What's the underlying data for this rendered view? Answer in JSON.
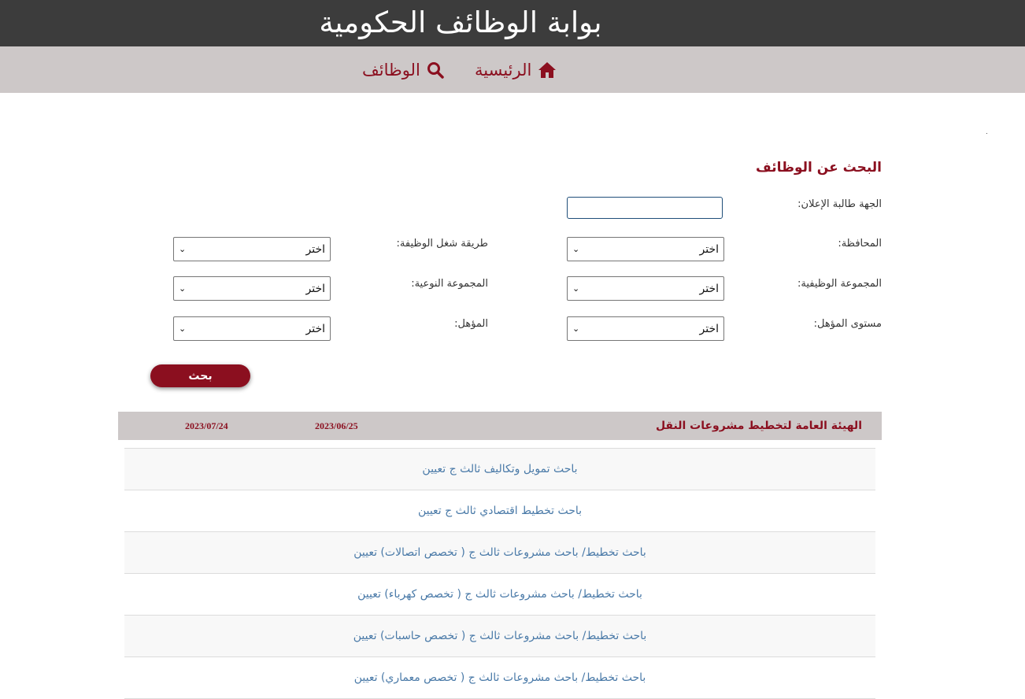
{
  "header": {
    "title": "بوابة الوظائف الحكومية"
  },
  "nav": {
    "home": "الرئيسية",
    "jobs": "الوظائف"
  },
  "search": {
    "heading": "البحث عن الوظائف",
    "labels": {
      "announcer": "الجهة طالبة الإعلان:",
      "governorate": "المحافظة:",
      "occupancy_method": "طريقة شغل الوظيفة:",
      "job_group": "المجموعة الوظيفية:",
      "qualitative_group": "المجموعة النوعية:",
      "qualification_level": "مستوى المؤهل:",
      "qualification": "المؤهل:"
    },
    "announcer_value": "",
    "select_default": "اختر",
    "button": "بحث"
  },
  "results": {
    "organization": "الهيئة العامة لتخطيط مشروعات النقل",
    "start_date": "2023/06/25",
    "end_date": "2023/07/24",
    "jobs": [
      "باحث تمويل وتكاليف ثالث ج تعيين",
      "باحث تخطيط اقتصادي ثالث ج تعيين",
      "باحث تخطيط/ باحث مشروعات ثالث ج ( تخصص اتصالات) تعيين",
      "باحث تخطيط/ باحث مشروعات ثالث ج ( تخصص كهرباء) تعيين",
      "باحث تخطيط/ باحث مشروعات ثالث ج ( تخصص حاسبات) تعيين",
      "باحث تخطيط/ باحث مشروعات ثالث ج ( تخصص معماري) تعيين"
    ]
  }
}
